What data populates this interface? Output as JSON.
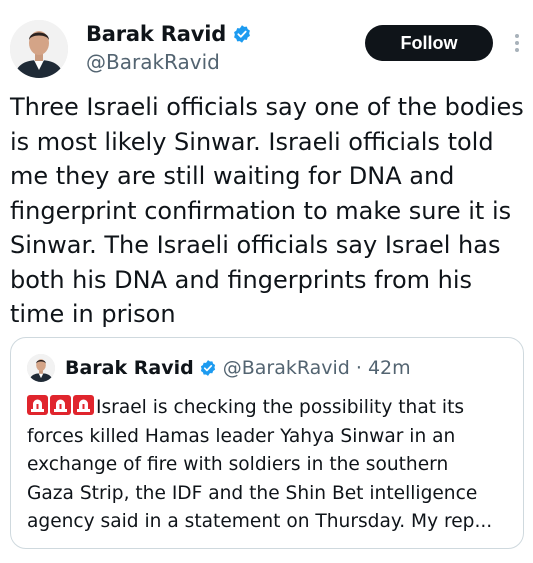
{
  "tweet": {
    "author": {
      "name": "Barak Ravid",
      "handle": "@BarakRavid",
      "verified": true,
      "verified_color": "#1d9bf0"
    },
    "follow_label": "Follow",
    "text": "Three Israeli officials say one of the bodies\nis most likely Sinwar. Israeli officials told\nme they are still waiting for DNA and\nfingerprint confirmation to make sure it is\nSinwar. The Israeli officials say Israel has\nboth his DNA and fingerprints from his\ntime in prison"
  },
  "quoted_tweet": {
    "author": {
      "name": "Barak Ravid",
      "handle": "@BarakRavid · 42m",
      "verified": true
    },
    "prefix_icons": [
      "siren-icon",
      "siren-icon",
      "siren-icon"
    ],
    "text": "Israel is checking the possibility that its\nforces killed Hamas leader Yahya Sinwar in an\nexchange of fire with soldiers in the southern\nGaza Strip, the IDF and the Shin Bet intelligence\nagency said in a statement on Thursday. My rep..."
  },
  "colors": {
    "text_primary": "#0f1419",
    "text_secondary": "#536471",
    "button_bg": "#0f1419",
    "border": "#cfd9de",
    "siren_red": "#e0252d"
  }
}
